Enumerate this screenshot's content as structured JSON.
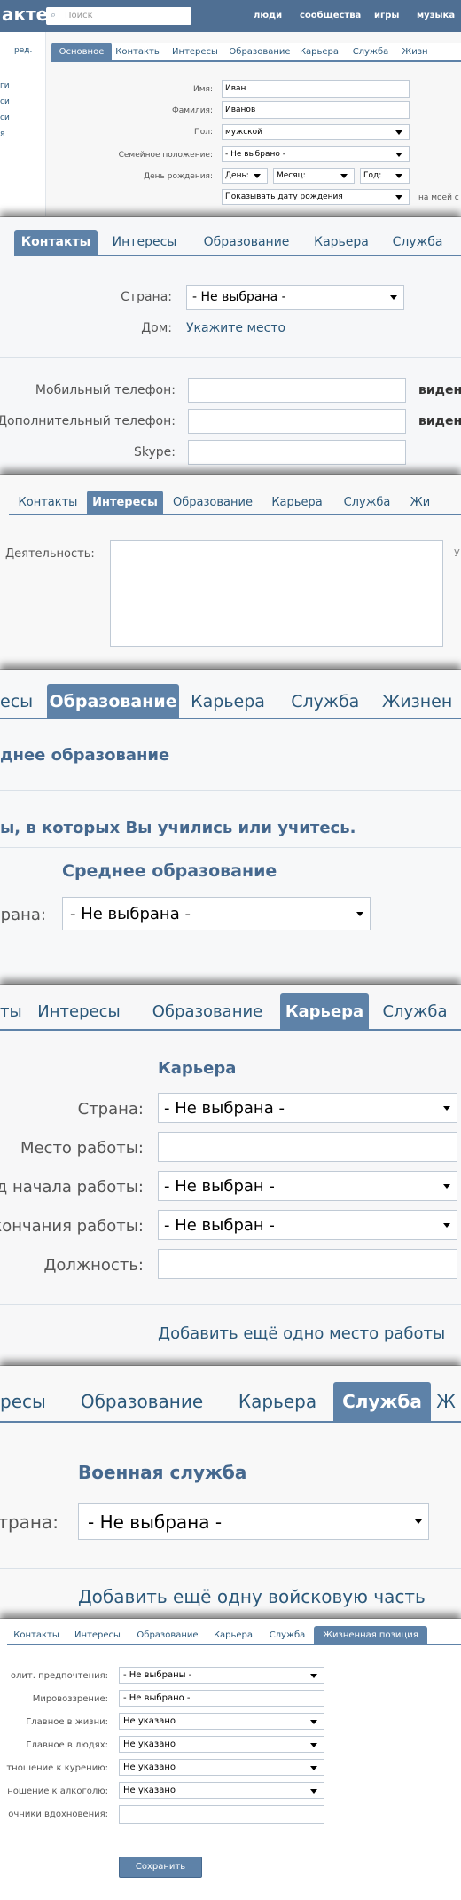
{
  "header": {
    "logo": "акте",
    "search_placeholder": "Поиск",
    "nav": [
      "люди",
      "сообщества",
      "игры",
      "музыка"
    ]
  },
  "sidebar": {
    "edit": "ред.",
    "items": [
      "ги",
      "си",
      "си",
      "я"
    ]
  },
  "basic": {
    "tabs": [
      "Основное",
      "Контакты",
      "Интересы",
      "Образование",
      "Карьера",
      "Служба",
      "Жизн"
    ],
    "labels": {
      "first": "Имя:",
      "last": "Фамилия:",
      "sex": "Пол:",
      "family": "Семейное положение:",
      "bday": "День рождения:"
    },
    "values": {
      "first": "Иван",
      "last": "Иванов",
      "sex": "мужской",
      "family": "- Не выбрано -",
      "day": "День:",
      "month": "Месяц:",
      "year": "Год:",
      "show": "Показывать дату рождения"
    },
    "note": "на моей с"
  },
  "contacts": {
    "tabs": [
      "Контакты",
      "Интересы",
      "Образование",
      "Карьера",
      "Служба"
    ],
    "country_label": "Страна:",
    "country_value": "- Не выбрана -",
    "home_label": "Дом:",
    "home_link": "Укажите место",
    "mobile_label": "Мобильный телефон:",
    "extra_label": "Дополнительный телефон:",
    "skype_label": "Skype:",
    "visible": "виден"
  },
  "interests": {
    "tabs": [
      "Контакты",
      "Интересы",
      "Образование",
      "Карьера",
      "Служба",
      "Жи"
    ],
    "activity_label": "Деятельность:",
    "side": "У"
  },
  "education": {
    "tabs": [
      "есы",
      "Образование",
      "Карьера",
      "Служба",
      "Жизнен"
    ],
    "heading": "днее образование",
    "subtitle": "ы, в которых Вы учились или учитесь.",
    "section": "Среднее образование",
    "country_label": "рана:",
    "country_value": "- Не выбрана -"
  },
  "career": {
    "tabs": [
      "ты",
      "Интересы",
      "Образование",
      "Карьера",
      "Служба"
    ],
    "section": "Карьера",
    "labels": [
      "Страна:",
      "Место работы:",
      "од начала работы:",
      "окончания работы:",
      "Должность:"
    ],
    "values": [
      "- Не выбрана -",
      "",
      "- Не выбран -",
      "- Не выбран -",
      ""
    ],
    "add": "Добавить ещё одно место работы"
  },
  "service": {
    "tabs": [
      "ресы",
      "Образование",
      "Карьера",
      "Служба",
      "Ж"
    ],
    "section": "Военная служба",
    "country_label": "трана:",
    "country_value": "- Не выбрана -",
    "add": "Добавить ещё одну войсковую часть"
  },
  "life": {
    "tabs": [
      "Контакты",
      "Интересы",
      "Образование",
      "Карьера",
      "Служба",
      "Жизненная позиция"
    ],
    "labels": [
      "олит. предпочтения:",
      "Мировоззрение:",
      "Главное в жизни:",
      "Главное в людях:",
      "тношение к курению:",
      "ношение к алкоголю:",
      "очники вдохновения:"
    ],
    "values": [
      "- Не выбраны -",
      "- Не выбрано -",
      "Не указано",
      "Не указано",
      "Не указано",
      "Не указано",
      ""
    ],
    "save": "Сохранить"
  }
}
